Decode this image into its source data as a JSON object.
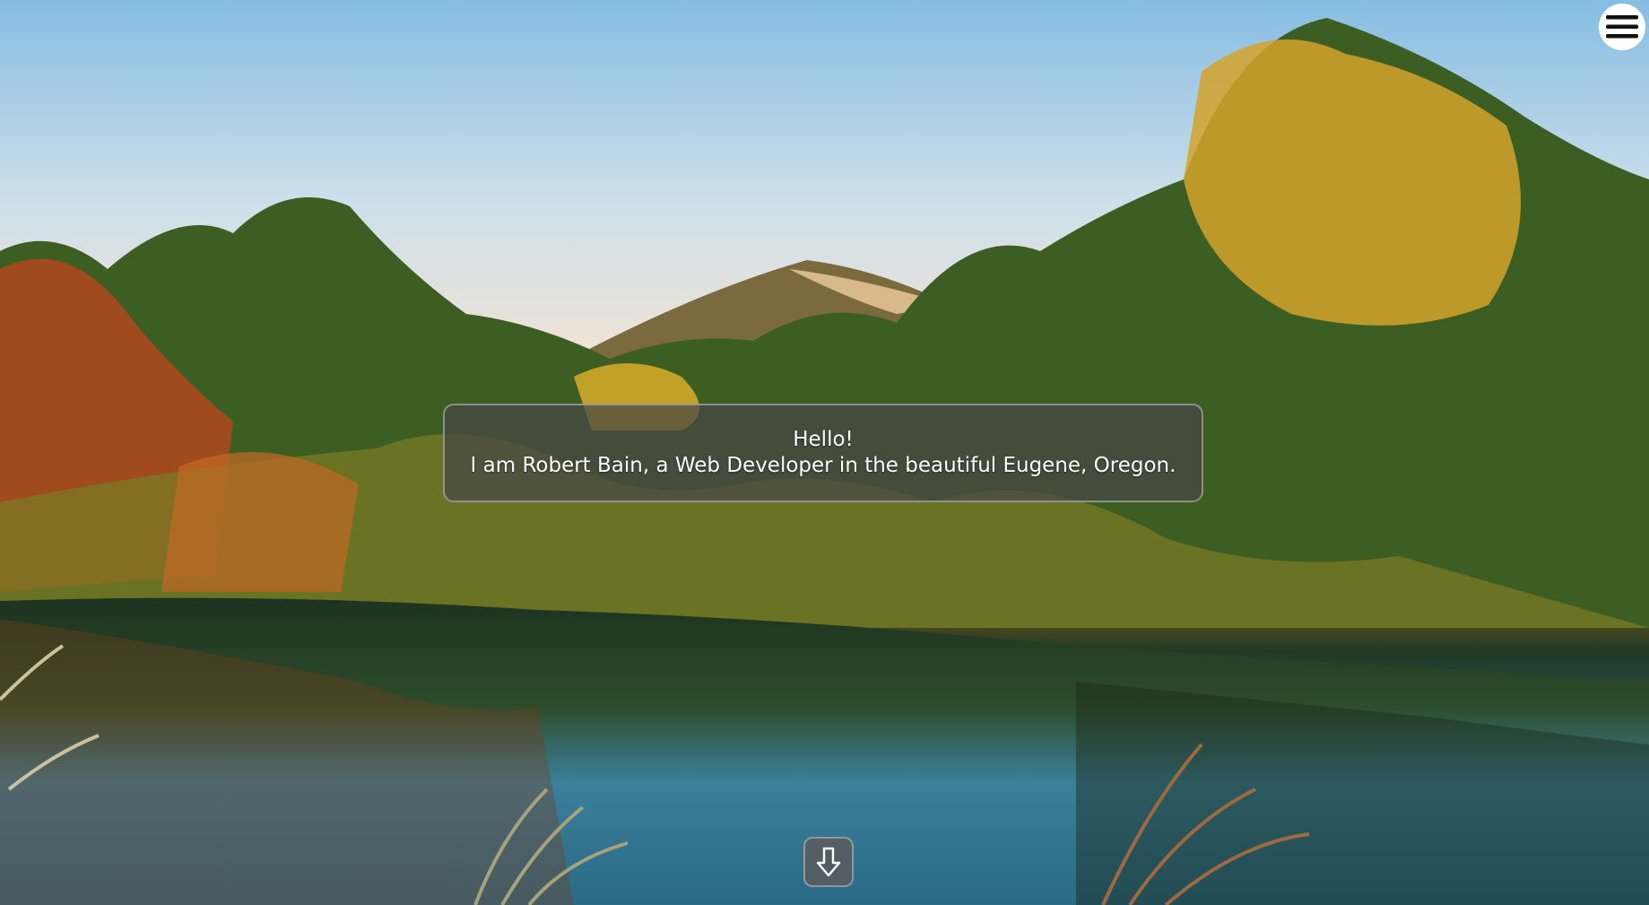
{
  "hero": {
    "greeting_line1": "Hello!",
    "greeting_line2": "I am Robert Bain, a Web Developer in the beautiful Eugene, Oregon."
  },
  "icons": {
    "menu": "hamburger-menu-icon",
    "scroll": "arrow-down-icon"
  },
  "colors": {
    "greeting_panel": "#464646",
    "greeting_text": "#ffffff",
    "menu_button": "#ffffff",
    "scroll_button": "#5a5a5a"
  }
}
